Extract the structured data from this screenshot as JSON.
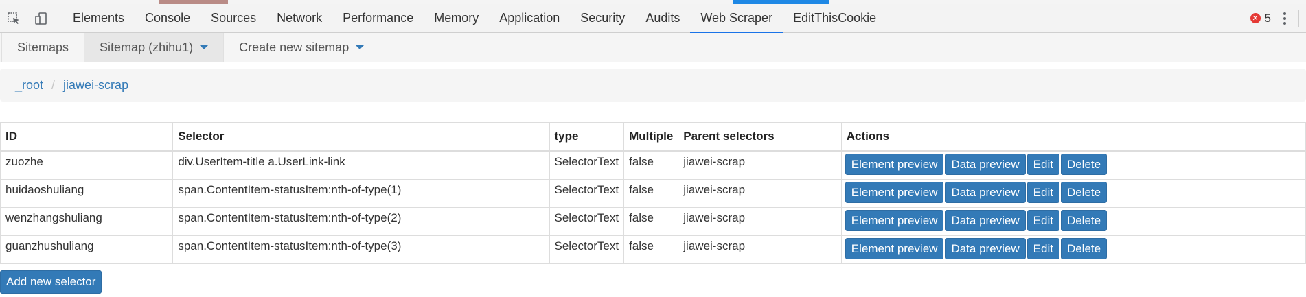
{
  "devtools": {
    "tabs": [
      {
        "label": "Elements",
        "active": false
      },
      {
        "label": "Console",
        "active": false
      },
      {
        "label": "Sources",
        "active": false
      },
      {
        "label": "Network",
        "active": false
      },
      {
        "label": "Performance",
        "active": false
      },
      {
        "label": "Memory",
        "active": false
      },
      {
        "label": "Application",
        "active": false
      },
      {
        "label": "Security",
        "active": false
      },
      {
        "label": "Audits",
        "active": false
      },
      {
        "label": "Web Scraper",
        "active": true
      },
      {
        "label": "EditThisCookie",
        "active": false
      }
    ],
    "error_count": "5",
    "accent_color": "#1a73e8",
    "error_color": "#e53935"
  },
  "sitemap_nav": {
    "sitemaps": "Sitemaps",
    "current_sitemap": "Sitemap (zhihu1)",
    "create_new": "Create new sitemap"
  },
  "breadcrumb": {
    "root": "_root",
    "separator": "/",
    "current": "jiawei-scrap"
  },
  "table": {
    "headers": {
      "id": "ID",
      "selector": "Selector",
      "type": "type",
      "multiple": "Multiple",
      "parent": "Parent selectors",
      "actions": "Actions"
    },
    "rows": [
      {
        "id": "zuozhe",
        "selector": "div.UserItem-title a.UserLink-link",
        "type": "SelectorText",
        "multiple": "false",
        "parent": "jiawei-scrap"
      },
      {
        "id": "huidaoshuliang",
        "selector": "span.ContentItem-statusItem:nth-of-type(1)",
        "type": "SelectorText",
        "multiple": "false",
        "parent": "jiawei-scrap"
      },
      {
        "id": "wenzhangshuliang",
        "selector": "span.ContentItem-statusItem:nth-of-type(2)",
        "type": "SelectorText",
        "multiple": "false",
        "parent": "jiawei-scrap"
      },
      {
        "id": "guanzhushuliang",
        "selector": "span.ContentItem-statusItem:nth-of-type(3)",
        "type": "SelectorText",
        "multiple": "false",
        "parent": "jiawei-scrap"
      }
    ],
    "action_labels": {
      "element_preview": "Element preview",
      "data_preview": "Data preview",
      "edit": "Edit",
      "delete": "Delete"
    }
  },
  "add_selector_label": "Add new selector",
  "button_color": "#337ab7"
}
